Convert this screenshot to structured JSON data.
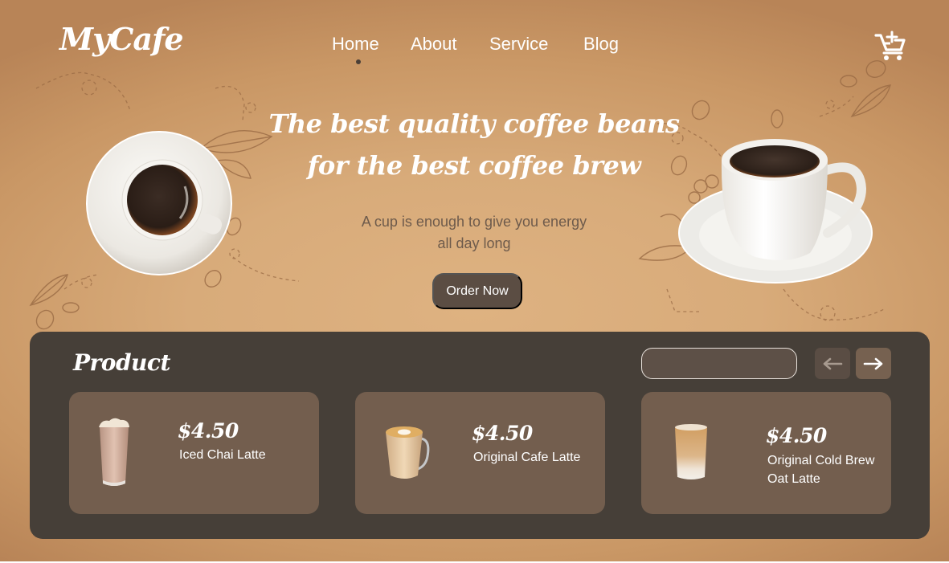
{
  "brand": {
    "logo": "MyCafe"
  },
  "nav": {
    "items": [
      {
        "label": "Home",
        "active": true
      },
      {
        "label": "About",
        "active": false
      },
      {
        "label": "Service",
        "active": false
      },
      {
        "label": "Blog",
        "active": false
      }
    ],
    "cart_icon": "cart-plus-icon"
  },
  "hero": {
    "headline_line1": "The best quality coffee beans",
    "headline_line2": "for the best coffee brew",
    "subline_line1": "A cup is enough to give you energy",
    "subline_line2": "all day long",
    "cta_label": "Order Now"
  },
  "products": {
    "title": "Product",
    "search": {
      "value": "",
      "placeholder": "",
      "icon": "search-icon"
    },
    "prev_icon": "arrow-left-icon",
    "next_icon": "arrow-right-icon",
    "items": [
      {
        "price": "$4.50",
        "name": "Iced Chai Latte",
        "image": "iced-chai-latte-glass"
      },
      {
        "price": "$4.50",
        "name": "Original Cafe Latte",
        "image": "cafe-latte-mug"
      },
      {
        "price": "$4.50",
        "name": "Original Cold Brew Oat Latte",
        "image": "cold-brew-oat-latte-glass"
      }
    ]
  },
  "colors": {
    "background": "#d8ab7a",
    "panel": "#463f38",
    "card": "#735e4e",
    "button": "#5b4d43",
    "text_muted": "#6e5b4c",
    "white": "#ffffff"
  }
}
